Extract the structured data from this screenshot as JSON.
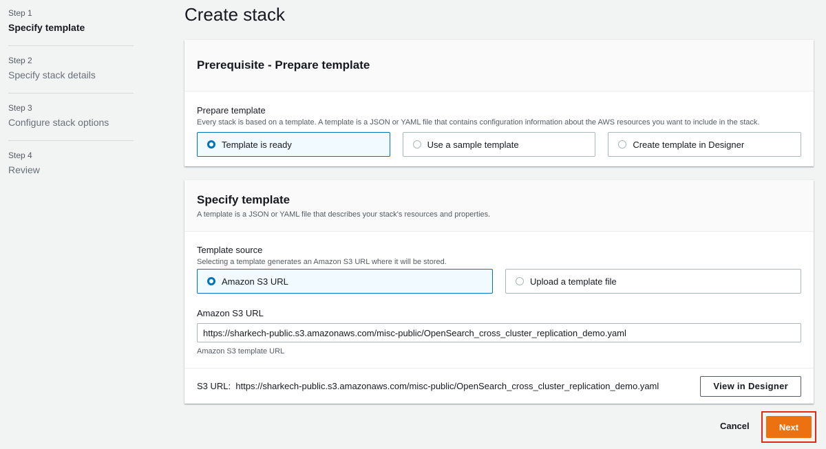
{
  "steps": [
    {
      "num": "Step 1",
      "title": "Specify template"
    },
    {
      "num": "Step 2",
      "title": "Specify stack details"
    },
    {
      "num": "Step 3",
      "title": "Configure stack options"
    },
    {
      "num": "Step 4",
      "title": "Review"
    }
  ],
  "page_title": "Create stack",
  "prereq": {
    "header": "Prerequisite - Prepare template",
    "label": "Prepare template",
    "desc": "Every stack is based on a template. A template is a JSON or YAML file that contains configuration information about the AWS resources you want to include in the stack.",
    "options": [
      "Template is ready",
      "Use a sample template",
      "Create template in Designer"
    ],
    "selected": "Template is ready"
  },
  "specify": {
    "header": "Specify template",
    "header_desc": "A template is a JSON or YAML file that describes your stack's resources and properties.",
    "source_label": "Template source",
    "source_desc": "Selecting a template generates an Amazon S3 URL where it will be stored.",
    "options": [
      "Amazon S3 URL",
      "Upload a template file"
    ],
    "selected": "Amazon S3 URL",
    "url_label": "Amazon S3 URL",
    "url_value": "https://sharkech-public.s3.amazonaws.com/misc-public/OpenSearch_cross_cluster_replication_demo.yaml",
    "url_hint": "Amazon S3 template URL",
    "s3_url_prefix": "S3 URL:",
    "s3_url": "https://sharkech-public.s3.amazonaws.com/misc-public/OpenSearch_cross_cluster_replication_demo.yaml",
    "designer_button": "View in Designer"
  },
  "actions": {
    "cancel": "Cancel",
    "next": "Next"
  },
  "colors": {
    "accent": "#0073bb",
    "primary_button": "#ec7211",
    "highlight_box": "#e0291c"
  }
}
